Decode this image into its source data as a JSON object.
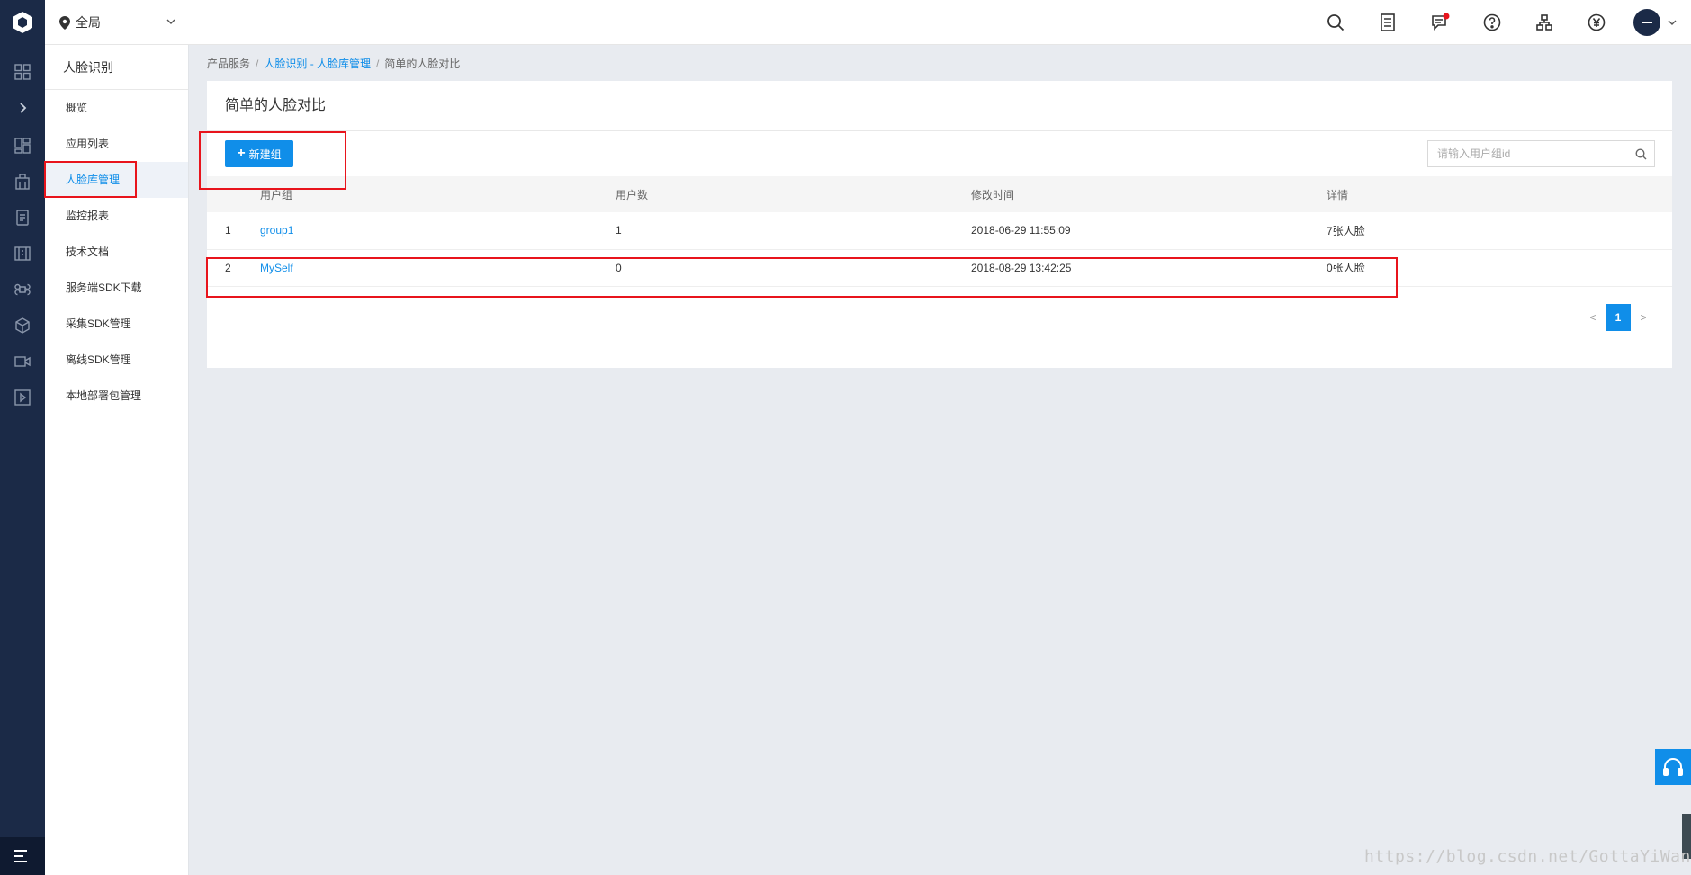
{
  "header": {
    "region_label": "全局",
    "icons": [
      "search-icon",
      "order-list-icon",
      "message-icon",
      "help-icon",
      "network-icon",
      "yen-icon",
      "avatar"
    ]
  },
  "rail": {
    "icons": [
      "logo-icon",
      "grid-icon",
      "expand-icon",
      "dashboard-icon",
      "building-icon",
      "doc-icon",
      "book-icon",
      "cmd-icon",
      "cube-icon",
      "camera-icon",
      "play-icon",
      "menu-icon"
    ]
  },
  "sidebar": {
    "title": "人脸识别",
    "items": [
      {
        "label": "概览"
      },
      {
        "label": "应用列表"
      },
      {
        "label": "人脸库管理",
        "active": true
      },
      {
        "label": "监控报表"
      },
      {
        "label": "技术文档"
      },
      {
        "label": "服务端SDK下载"
      },
      {
        "label": "采集SDK管理"
      },
      {
        "label": "离线SDK管理"
      },
      {
        "label": "本地部署包管理"
      }
    ]
  },
  "breadcrumb": {
    "root": "产品服务",
    "sep": "/",
    "link": "人脸识别 - 人脸库管理",
    "current": "简单的人脸对比"
  },
  "panel": {
    "title": "简单的人脸对比",
    "new_button": "新建组",
    "search_placeholder": "请输入用户组id"
  },
  "table": {
    "headers": [
      "",
      "用户组",
      "用户数",
      "修改时间",
      "详情"
    ],
    "rows": [
      {
        "index": "1",
        "group": "group1",
        "users": "1",
        "time": "2018-06-29 11:55:09",
        "detail": "7张人脸"
      },
      {
        "index": "2",
        "group": "MySelf",
        "users": "0",
        "time": "2018-08-29 13:42:25",
        "detail": "0张人脸"
      }
    ]
  },
  "pagination": {
    "prev": "<",
    "page": "1",
    "next": ">"
  },
  "watermark": "https://blog.csdn.net/GottaYiWanLiu",
  "colors": {
    "accent": "#108ee9",
    "rail": "#1b2a47",
    "annotation": "#e8141c"
  }
}
